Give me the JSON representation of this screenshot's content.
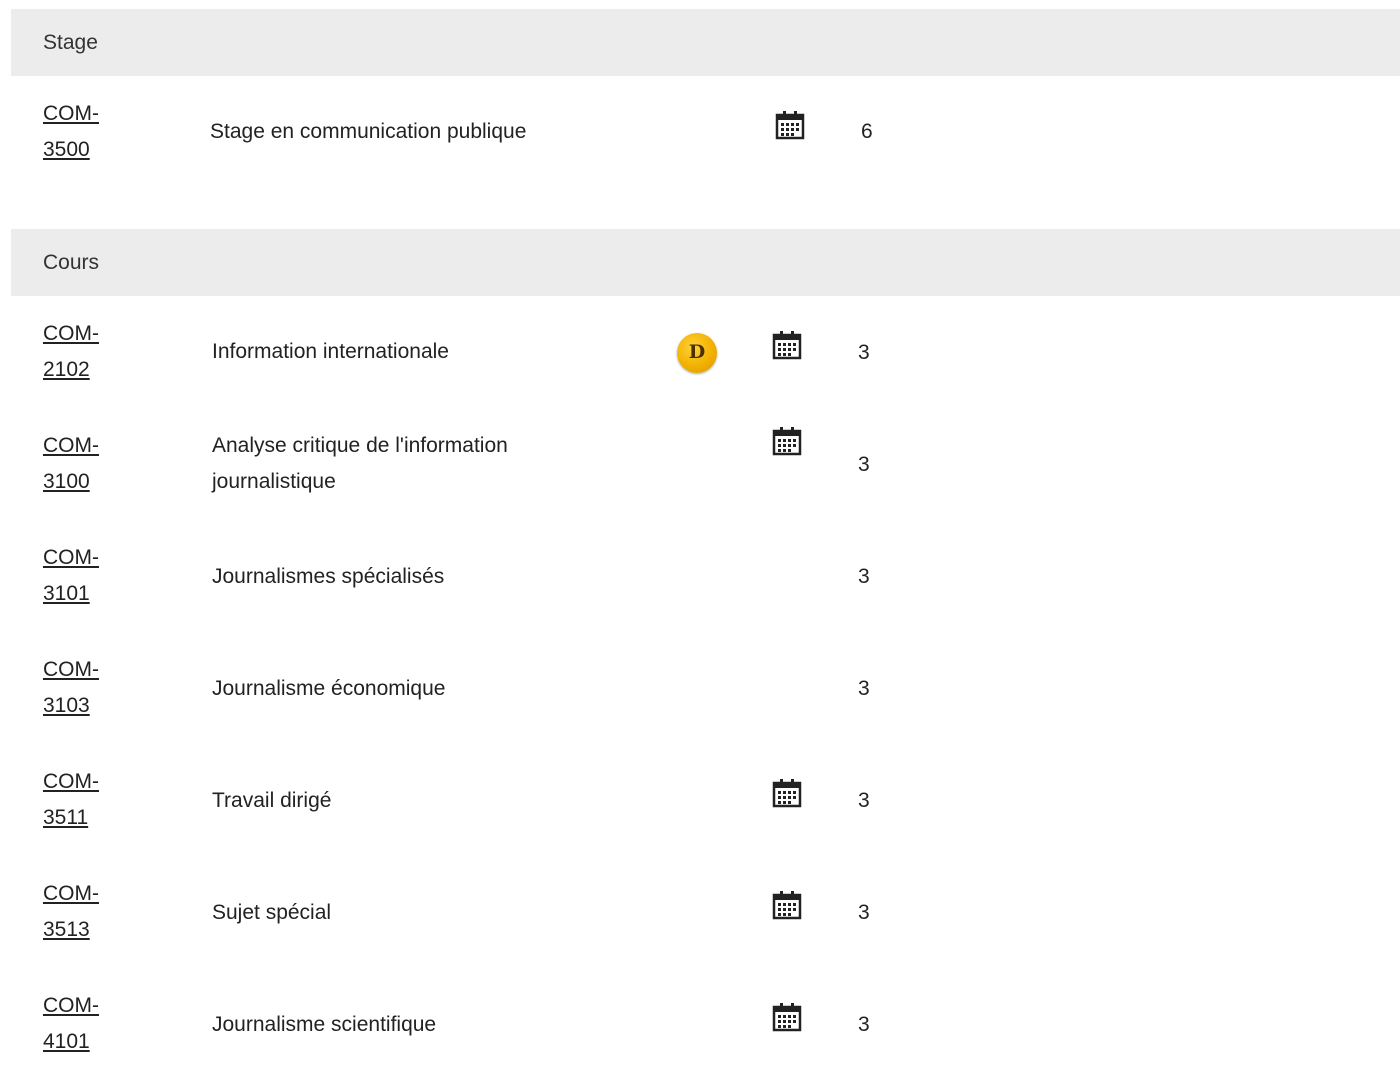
{
  "sections": [
    {
      "label": "Stage",
      "courses": [
        {
          "code_line1": "COM-",
          "code_line2": "3500",
          "title": "Stage en communication publique",
          "credits": "6",
          "badge": "",
          "calendar_icon": "calendar-icon"
        }
      ]
    },
    {
      "label": "Cours",
      "courses": [
        {
          "code_line1": "COM-",
          "code_line2": "2102",
          "title": "Information internationale",
          "credits": "3",
          "badge": "D",
          "calendar_icon": "calendar-icon"
        },
        {
          "code_line1": "COM-",
          "code_line2": "3100",
          "title": "Analyse critique de l'information journalistique",
          "credits": "3",
          "badge": "",
          "calendar_icon": "calendar-icon"
        },
        {
          "code_line1": "COM-",
          "code_line2": "3101",
          "title": "Journalismes spécialisés",
          "credits": "3",
          "badge": "",
          "calendar_icon": ""
        },
        {
          "code_line1": "COM-",
          "code_line2": "3103",
          "title": "Journalisme économique",
          "credits": "3",
          "badge": "",
          "calendar_icon": ""
        },
        {
          "code_line1": "COM-",
          "code_line2": "3511",
          "title": "Travail dirigé",
          "credits": "3",
          "badge": "",
          "calendar_icon": "calendar-icon"
        },
        {
          "code_line1": "COM-",
          "code_line2": "3513",
          "title": "Sujet spécial",
          "credits": "3",
          "badge": "",
          "calendar_icon": "calendar-icon"
        },
        {
          "code_line1": "COM-",
          "code_line2": "4101",
          "title": "Journalisme scientifique",
          "credits": "3",
          "badge": "",
          "calendar_icon": "calendar-icon"
        }
      ]
    }
  ],
  "colors": {
    "header_bg": "#ececec",
    "badge": "#f2b100",
    "text": "#222222"
  }
}
